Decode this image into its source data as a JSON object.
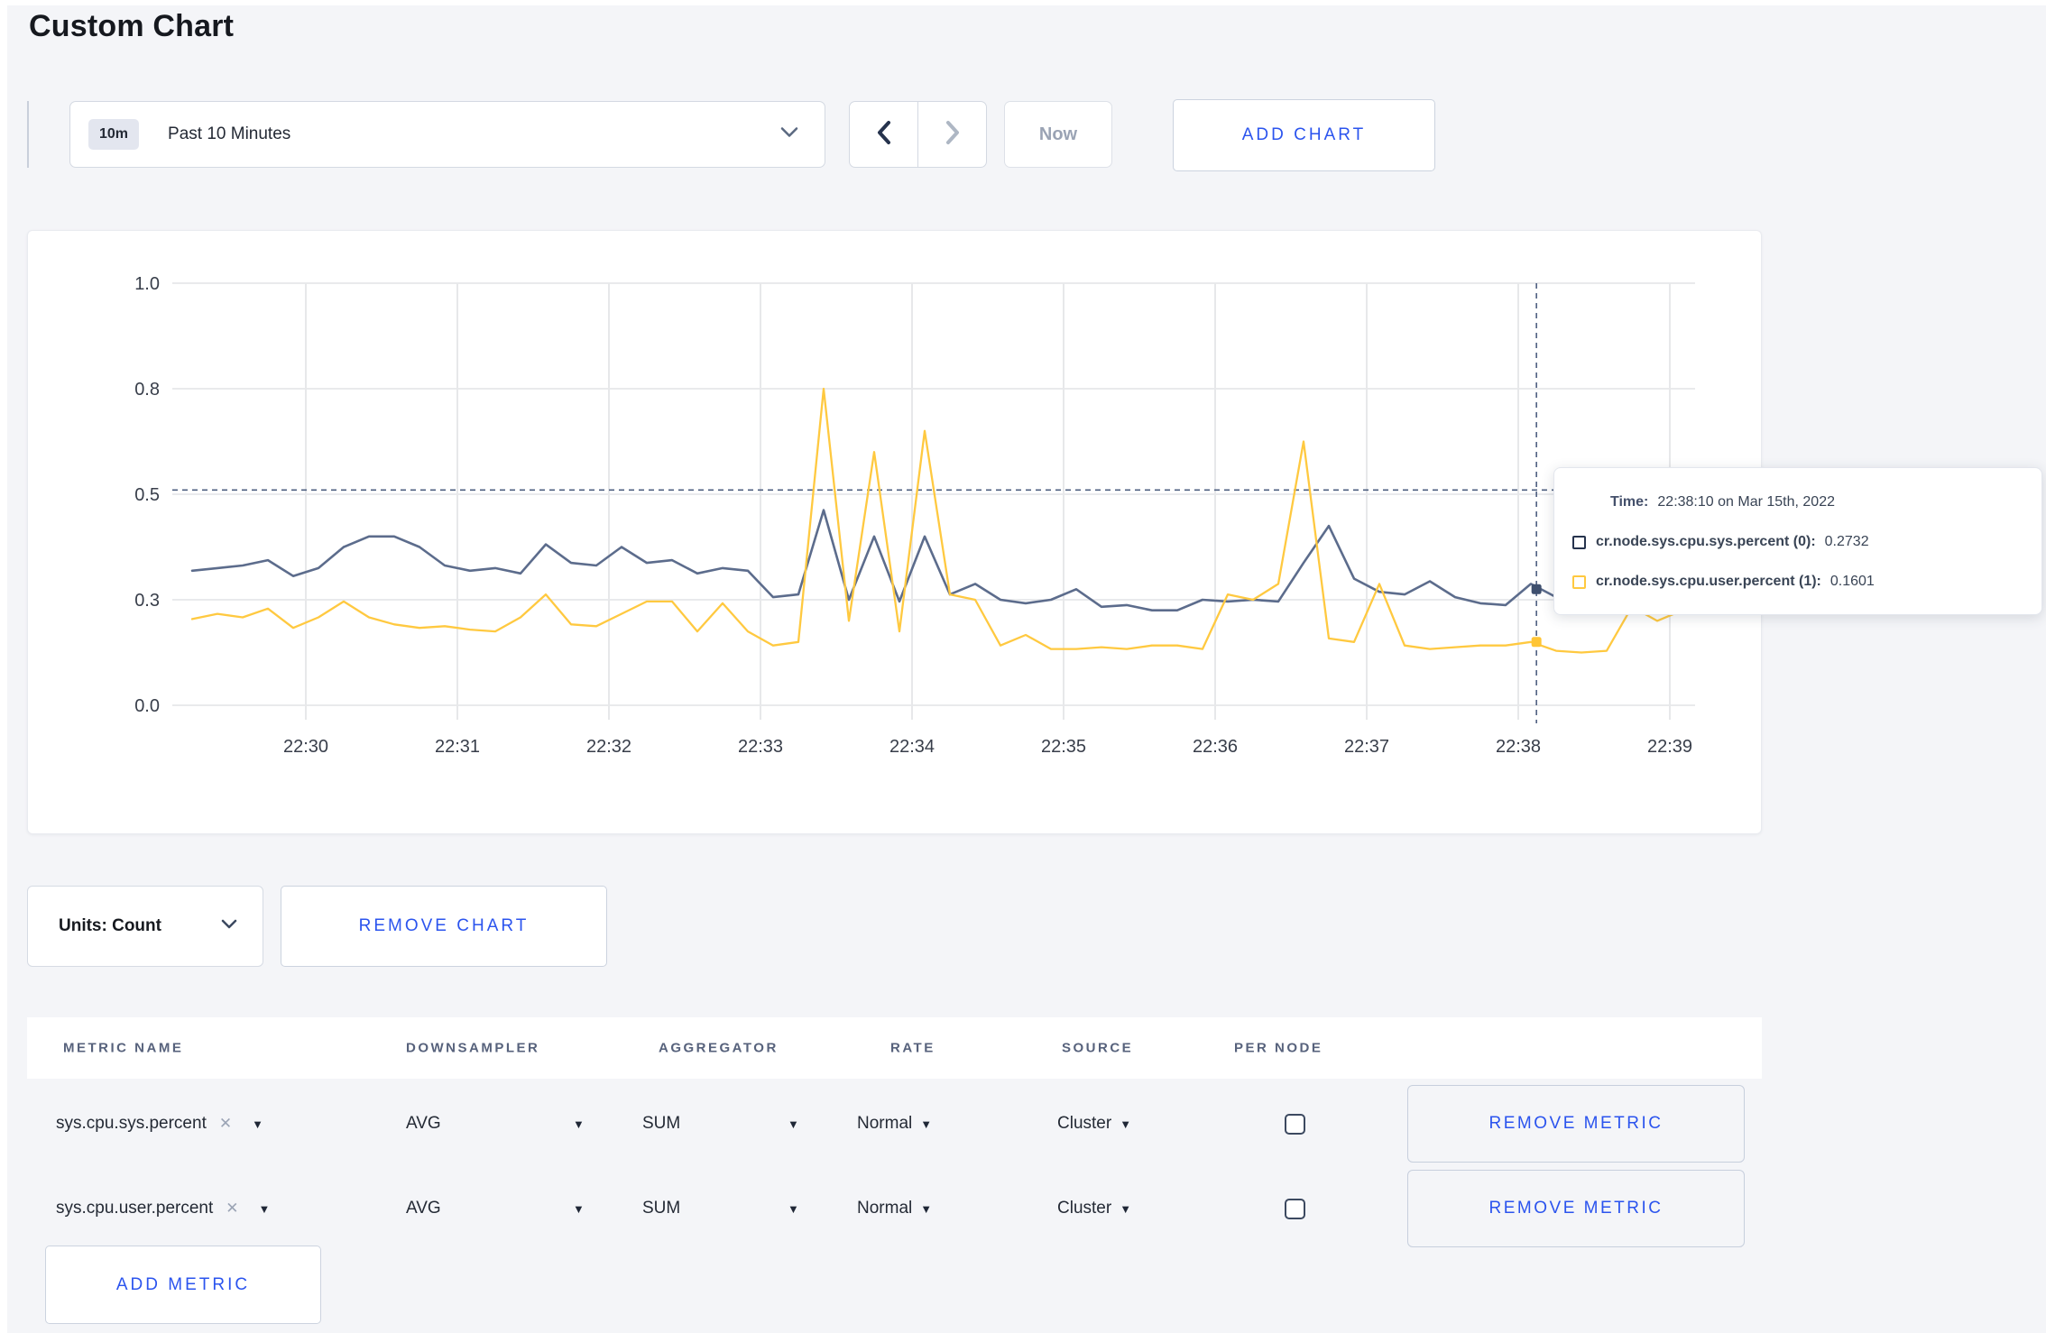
{
  "page": {
    "title": "Custom Chart"
  },
  "toolbar": {
    "time_range": {
      "badge": "10m",
      "label": "Past 10 Minutes"
    },
    "now_label": "Now",
    "add_chart_label": "ADD CHART"
  },
  "chart_card": {
    "tooltip": {
      "time_label": "Time:",
      "time_value": "22:38:10 on Mar 15th, 2022",
      "series": [
        {
          "name": "cr.node.sys.cpu.sys.percent (0):",
          "value": "0.2732",
          "color": "#26334d"
        },
        {
          "name": "cr.node.sys.cpu.user.percent (1):",
          "value": "0.1601",
          "color": "#ffc940"
        }
      ]
    }
  },
  "chart_data": {
    "type": "line",
    "title": "",
    "xlabel": "",
    "ylabel": "",
    "ylim": [
      0.0,
      1.0
    ],
    "grid": true,
    "y_ticks": [
      {
        "value": 0.0,
        "label": "0.0"
      },
      {
        "value": 0.3,
        "label": "0.3"
      },
      {
        "value": 0.5,
        "label": "0.5"
      },
      {
        "value": 0.8,
        "label": "0.8"
      },
      {
        "value": 1.0,
        "label": "1.0"
      }
    ],
    "x_ticks": [
      {
        "minute": 1,
        "label": "22:30"
      },
      {
        "minute": 2,
        "label": "22:31"
      },
      {
        "minute": 3,
        "label": "22:32"
      },
      {
        "minute": 4,
        "label": "22:33"
      },
      {
        "minute": 5,
        "label": "22:34"
      },
      {
        "minute": 6,
        "label": "22:35"
      },
      {
        "minute": 7,
        "label": "22:36"
      },
      {
        "minute": 8,
        "label": "22:37"
      },
      {
        "minute": 9,
        "label": "22:38"
      },
      {
        "minute": 10,
        "label": "22:39"
      }
    ],
    "series": [
      {
        "name": "cr.node.sys.cpu.sys.percent (0)",
        "color": "#5c6c8c",
        "start_minute": 0.25,
        "step_minute": 0.166667,
        "values": [
          0.355,
          0.36,
          0.365,
          0.375,
          0.345,
          0.36,
          0.4,
          0.42,
          0.42,
          0.4,
          0.365,
          0.355,
          0.36,
          0.35,
          0.405,
          0.37,
          0.365,
          0.4,
          0.37,
          0.375,
          0.35,
          0.36,
          0.355,
          0.305,
          0.31,
          0.47,
          0.3,
          0.42,
          0.295,
          0.42,
          0.31,
          0.33,
          0.3,
          0.29,
          0.3,
          0.32,
          0.28,
          0.285,
          0.27,
          0.27,
          0.3,
          0.295,
          0.3,
          0.295,
          0.37,
          0.44,
          0.34,
          0.315,
          0.31,
          0.335,
          0.305,
          0.29,
          0.285,
          0.33,
          0.305,
          0.3,
          0.295,
          0.3,
          0.31,
          0.3
        ]
      },
      {
        "name": "cr.node.sys.cpu.user.percent (1)",
        "color": "#ffc940",
        "start_minute": 0.25,
        "step_minute": 0.166667,
        "values": [
          0.245,
          0.26,
          0.25,
          0.275,
          0.22,
          0.25,
          0.295,
          0.25,
          0.23,
          0.22,
          0.225,
          0.215,
          0.21,
          0.25,
          0.31,
          0.23,
          0.225,
          0.26,
          0.295,
          0.295,
          0.21,
          0.29,
          0.21,
          0.17,
          0.18,
          0.8,
          0.24,
          0.62,
          0.21,
          0.68,
          0.31,
          0.3,
          0.17,
          0.2,
          0.16,
          0.16,
          0.165,
          0.16,
          0.17,
          0.17,
          0.16,
          0.31,
          0.3,
          0.33,
          0.65,
          0.19,
          0.18,
          0.33,
          0.17,
          0.16,
          0.165,
          0.17,
          0.17,
          0.18,
          0.155,
          0.15,
          0.155,
          0.28,
          0.24,
          0.27
        ]
      }
    ],
    "hover": {
      "minute": 9.12,
      "guide_value": 0.512,
      "point_values": [
        0.32,
        0.18
      ],
      "crosshair_color": "#4e5f80"
    },
    "legend_position": "tooltip"
  },
  "units_row": {
    "units_label": "Units: Count",
    "remove_chart_label": "REMOVE CHART"
  },
  "metrics_table": {
    "headers": [
      "METRIC NAME",
      "DOWNSAMPLER",
      "AGGREGATOR",
      "RATE",
      "SOURCE",
      "PER NODE"
    ],
    "clear_symbol": "✕",
    "rows": [
      {
        "name": "sys.cpu.sys.percent",
        "downsampler": "AVG",
        "aggregator": "SUM",
        "rate": "Normal",
        "source": "Cluster",
        "per_node_checked": false,
        "remove_label": "REMOVE METRIC"
      },
      {
        "name": "sys.cpu.user.percent",
        "downsampler": "AVG",
        "aggregator": "SUM",
        "rate": "Normal",
        "source": "Cluster",
        "per_node_checked": false,
        "remove_label": "REMOVE METRIC"
      }
    ],
    "add_metric_label": "ADD METRIC"
  }
}
